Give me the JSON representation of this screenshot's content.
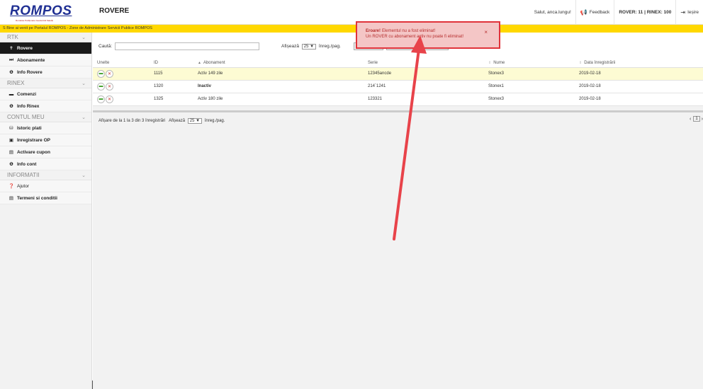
{
  "header": {
    "logo_text": "ROMPOS",
    "logo_sub": "România Poziționare Geodezică Sateliți",
    "page_title": "ROVERE",
    "greeting": "Salut, anca.lungu!",
    "feedback": "Feedback",
    "counts": "ROVER: 11 | RINEX: 100",
    "logout": "Ieșire"
  },
  "marquee": "S   Bine ai venit pe Portalul ROMPOS - Zone de Administrare Servicii Publice ROMPOS",
  "sidebar": {
    "sections": [
      {
        "title": "RTK",
        "items": [
          "Rovere",
          "Abonamente",
          "Info Rovere"
        ]
      },
      {
        "title": "RINEX",
        "items": [
          "Comenzi",
          "Info Rinex"
        ]
      },
      {
        "title": "CONTUL MEU",
        "items": [
          "Istoric plati",
          "Inregistrare OP",
          "Activare cupon",
          "Info cont"
        ]
      },
      {
        "title": "INFORMATII",
        "items": [
          "Ajutor",
          "Termeni si conditii"
        ]
      }
    ]
  },
  "toolbar": {
    "search_label": "Caută:",
    "search_value": "",
    "per_page_prefix": "Afișează",
    "per_page_value": "25",
    "per_page_suffix": "înreg./pag."
  },
  "table": {
    "headers": [
      "Unelte",
      "ID",
      "Abonament",
      "Serie",
      "Nume",
      "Data înregistrării"
    ],
    "rows": [
      {
        "id": "1115",
        "abonament": "Activ 149 zile",
        "serie": "12345ancde",
        "nume": "Stonex3",
        "data": "2019-02-18",
        "status": "active"
      },
      {
        "id": "1320",
        "abonament": "Inactiv",
        "serie": "214`1241",
        "nume": "Stonex1",
        "data": "2019-02-18",
        "status": "inactive"
      },
      {
        "id": "1325",
        "abonament": "Activ 180 zile",
        "serie": "123321",
        "nume": "Stonex3",
        "data": "2019-02-18",
        "status": "active"
      }
    ]
  },
  "footer": {
    "info": "Afișare de la 1 la 3 din 3 înregistrări",
    "per_page_prefix": "Afișează",
    "per_page_value": "25",
    "per_page_suffix": "înreg./pag.",
    "page": "1"
  },
  "toast": {
    "title": "Eroare!",
    "message": "Elementul nu a fost eliminat!",
    "detail": "Un ROVER cu abonament activ nu poate fi eliminat!",
    "close": "×"
  },
  "colors": {
    "accent_yellow": "#ffd800",
    "brand_blue": "#1f2f93",
    "error_red": "#e0333a",
    "active_green": "#3a9d23"
  }
}
